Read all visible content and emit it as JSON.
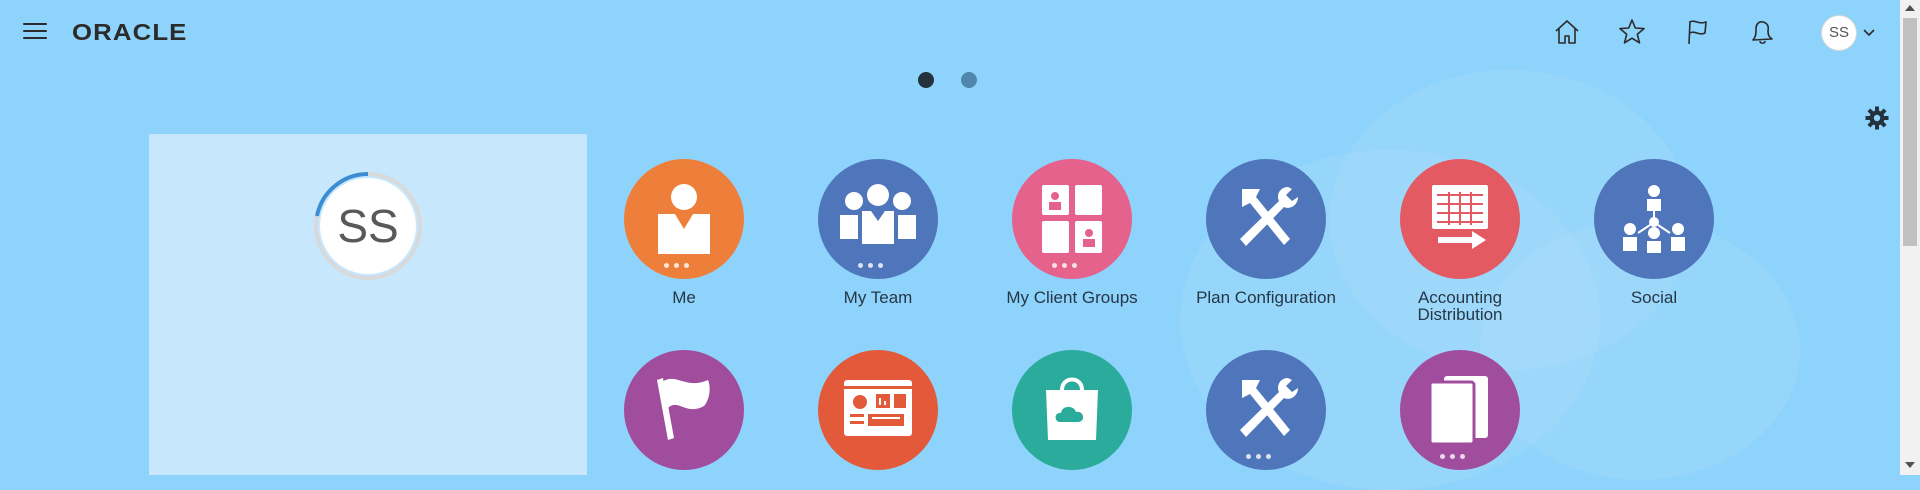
{
  "header": {
    "logo": "ORACLE",
    "icons": [
      "home-icon",
      "favorites-icon",
      "watchlist-flag-icon",
      "notifications-bell-icon"
    ],
    "user_initials": "SS"
  },
  "pager": {
    "pages": 2,
    "active": 1
  },
  "profile": {
    "initials": "SS",
    "progress": 0.22
  },
  "colors": {
    "background": "#8ed3fb",
    "panel": "#c6e7fc",
    "orange": "#ee7f3b",
    "blue": "#4f76bb",
    "pink": "#e4628b",
    "red": "#e35a63",
    "purple": "#a04d9e",
    "coral": "#e35a3a",
    "teal": "#2bab9c"
  },
  "tiles": [
    {
      "label": "Me",
      "icon": "person-icon",
      "color": "#ee7f3b"
    },
    {
      "label": "My Team",
      "icon": "team-icon",
      "color": "#4f76bb"
    },
    {
      "label": "My Client Groups",
      "icon": "client-groups-icon",
      "color": "#e4628b"
    },
    {
      "label": "Plan Configuration",
      "icon": "tools-icon",
      "color": "#4f76bb"
    },
    {
      "label": "Accounting Distribution",
      "icon": "spreadsheet-arrow-icon",
      "color": "#e35a63"
    },
    {
      "label": "Social",
      "icon": "org-chart-icon",
      "color": "#4f76bb"
    },
    {
      "label": "",
      "icon": "flag-icon",
      "color": "#a04d9e"
    },
    {
      "label": "",
      "icon": "dashboard-icon",
      "color": "#e35a3a"
    },
    {
      "label": "",
      "icon": "shopping-bag-icon",
      "color": "#2bab9c"
    },
    {
      "label": "",
      "icon": "tools-icon",
      "color": "#4f76bb"
    },
    {
      "label": "",
      "icon": "documents-icon",
      "color": "#a04d9e"
    }
  ]
}
